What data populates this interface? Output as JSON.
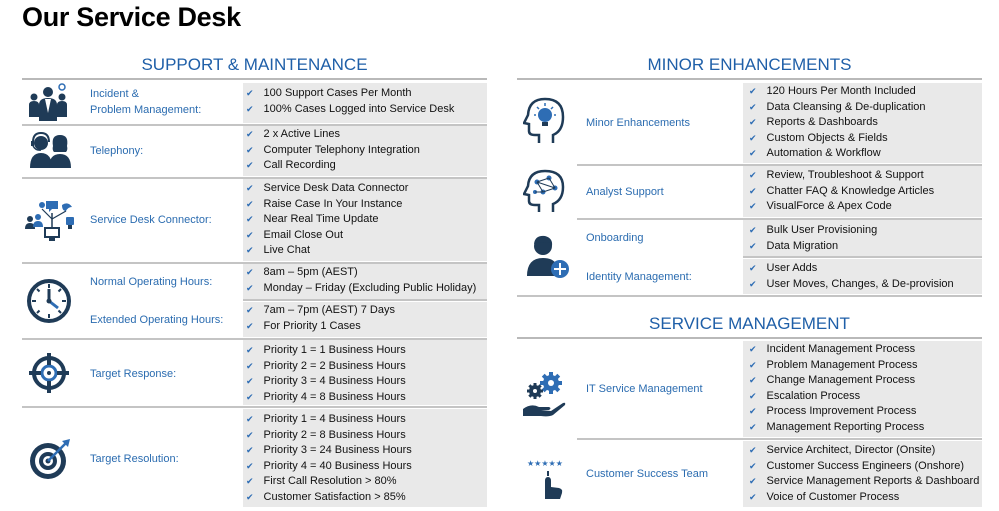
{
  "page_title": "Our Service Desk",
  "support": {
    "heading": "SUPPORT & MAINTENANCE",
    "items": [
      {
        "label_lines": [
          "Incident &",
          "Problem Management:"
        ],
        "bullets": [
          "100 Support Cases Per Month",
          "100% Cases Logged into Service Desk"
        ]
      },
      {
        "label_lines": [
          "Telephony:"
        ],
        "bullets": [
          "2 x Active Lines",
          "Computer Telephony Integration",
          "Call Recording"
        ]
      },
      {
        "label_lines": [
          "Service Desk Connector:"
        ],
        "bullets": [
          "Service Desk Data Connector",
          "Raise Case In Your Instance",
          "Near Real Time Update",
          "Email Close Out",
          "Live Chat"
        ]
      },
      {
        "label_lines": [
          "Normal Operating Hours:"
        ],
        "bullets": [
          "8am – 5pm (AEST)",
          "Monday – Friday (Excluding Public Holiday)"
        ]
      },
      {
        "label_lines": [
          "Extended Operating Hours:"
        ],
        "bullets": [
          "7am – 7pm (AEST) 7 Days",
          "For Priority 1 Cases"
        ]
      },
      {
        "label_lines": [
          "Target Response:"
        ],
        "bullets": [
          "Priority 1 = 1 Business Hours",
          "Priority 2 = 2 Business Hours",
          "Priority 3 = 4 Business Hours",
          "Priority 4 = 8 Business Hours"
        ]
      },
      {
        "label_lines": [
          "Target Resolution:"
        ],
        "bullets": [
          "Priority 1 = 4 Business Hours",
          "Priority 2 = 8 Business Hours",
          "Priority 3 = 24 Business Hours",
          "Priority 4 = 40 Business Hours",
          "First Call Resolution > 80%",
          "Customer Satisfaction > 85%"
        ]
      }
    ]
  },
  "minor": {
    "heading": "MINOR ENHANCEMENTS",
    "items": [
      {
        "label_lines": [
          "Minor Enhancements"
        ],
        "bullets": [
          "120 Hours Per Month Included",
          "Data Cleansing & De-duplication",
          "Reports & Dashboards",
          "Custom Objects & Fields",
          "Automation & Workflow"
        ]
      },
      {
        "label_lines": [
          "Analyst Support"
        ],
        "bullets": [
          "Review, Troubleshoot & Support",
          "Chatter FAQ & Knowledge Articles",
          "VisualForce & Apex Code"
        ]
      },
      {
        "label_lines": [
          "Onboarding"
        ],
        "bullets": [
          "Bulk User Provisioning",
          "Data Migration"
        ]
      },
      {
        "label_lines": [
          "Identity Management:"
        ],
        "bullets": [
          "User Adds",
          "User Moves, Changes, & De-provision"
        ]
      }
    ]
  },
  "service": {
    "heading": "SERVICE MANAGEMENT",
    "items": [
      {
        "label_lines": [
          "IT Service Management"
        ],
        "bullets": [
          "Incident Management Process",
          "Problem Management Process",
          "Change Management Process",
          "Escalation Process",
          "Process Improvement Process",
          "Management Reporting Process"
        ]
      },
      {
        "label_lines": [
          "Customer Success Team"
        ],
        "bullets": [
          "Service Architect, Director (Onsite)",
          "Customer Success Engineers (Onshore)",
          "Service Management Reports & Dashboard",
          "Voice of Customer Process"
        ]
      }
    ]
  },
  "colors": {
    "accent": "#1f5fa8",
    "label": "#2b6cb0",
    "panel": "#e9e9e9",
    "icon": "#1f3b57"
  },
  "icons": [
    "team-icon",
    "headset-agents-icon",
    "social-connector-icon",
    "clock-icon",
    "crosshair-target-icon",
    "bullseye-target-icon",
    "lightbulb-head-icon",
    "network-head-icon",
    "user-add-icon",
    "gears-hand-icon",
    "five-star-rating-icon"
  ]
}
